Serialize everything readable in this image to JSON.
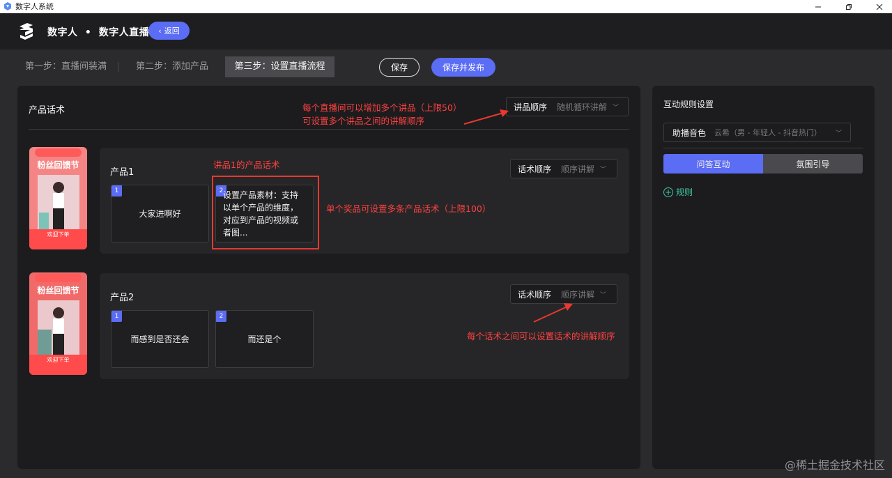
{
  "window": {
    "title": "数字人系统"
  },
  "header": {
    "app_name": "数字人",
    "separator": "•",
    "section": "数字人直播",
    "back_label": "返回"
  },
  "steps": {
    "items": [
      {
        "label": "第一步：直播间装满",
        "active": false
      },
      {
        "label": "第二步：添加产品",
        "active": false
      },
      {
        "label": "第三步：设置直播流程",
        "active": true
      }
    ],
    "save_label": "保存",
    "publish_label": "保存并发布"
  },
  "main": {
    "title": "产品话术",
    "order_label": "讲品顺序",
    "order_value": "随机循环讲解",
    "products": [
      {
        "name": "产品1",
        "order_label": "话术顺序",
        "order_value": "顺序讲解",
        "thumb": {
          "title": "粉丝回馈节",
          "badge": "欢迎下单"
        },
        "scripts": [
          {
            "num": "1",
            "text": "大家进啊好"
          },
          {
            "num": "2",
            "text": "设置产品素材：支持以单个产品的维度，对应到产品的视频或者图..."
          }
        ]
      },
      {
        "name": "产品2",
        "order_label": "话术顺序",
        "order_value": "顺序讲解",
        "thumb": {
          "title": "粉丝回馈节",
          "badge": "欢迎下单"
        },
        "scripts": [
          {
            "num": "1",
            "text": "而感到是否还会"
          },
          {
            "num": "2",
            "text": "而还是个"
          }
        ]
      }
    ]
  },
  "annotations": {
    "top_line1": "每个直播间可以增加多个讲品（上限50）",
    "top_line2": "可设置多个讲品之间的讲解顺序",
    "script_label": "讲品1的产品话术",
    "script_limit": "单个奖品可设置多条产品话术（上限100）",
    "script_order": "每个话术之间可以设置话术的讲解顺序",
    "color": "#ff4040"
  },
  "side": {
    "title": "互动规则设置",
    "voice_label": "助播音色",
    "voice_value": "云希（男 - 年轻人 - 抖音热门）",
    "tabs": [
      {
        "label": "问答互动",
        "active": true
      },
      {
        "label": "氛围引导",
        "active": false
      }
    ],
    "add_rule_label": "规则"
  },
  "watermark": "@稀土掘金技术社区",
  "colors": {
    "accent": "#5b6cf5",
    "teal": "#3ec8a6",
    "panel": "#1c1c1e",
    "background": "#2b2b2e"
  }
}
